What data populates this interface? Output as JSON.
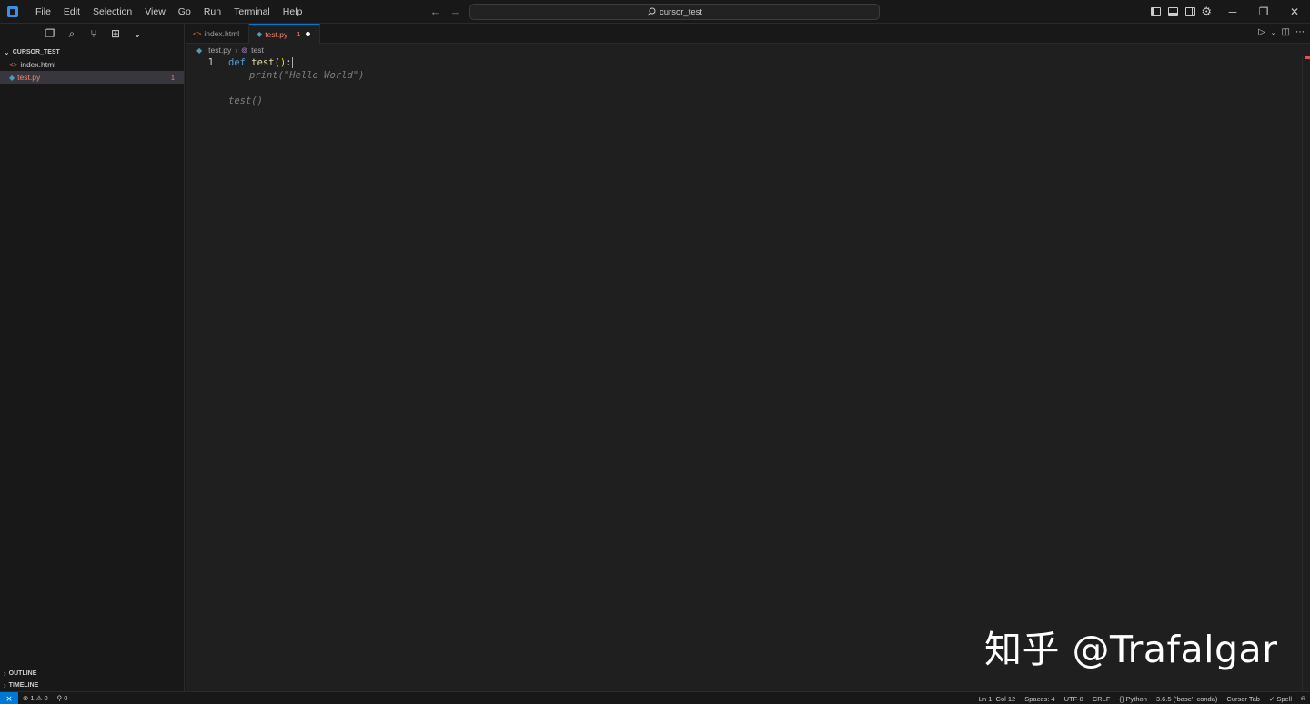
{
  "menu": [
    "File",
    "Edit",
    "Selection",
    "View",
    "Go",
    "Run",
    "Terminal",
    "Help"
  ],
  "command_center": {
    "label": "cursor_test",
    "icon": "search-icon"
  },
  "sidebar": {
    "folder": "CURSOR_TEST",
    "files": [
      {
        "name": "index.html",
        "icon": "html-file-icon",
        "badge": ""
      },
      {
        "name": "test.py",
        "icon": "python-file-icon",
        "badge": "1"
      }
    ],
    "sections": [
      "OUTLINE",
      "TIMELINE"
    ]
  },
  "tabs": [
    {
      "label": "index.html",
      "problems": ""
    },
    {
      "label": "test.py",
      "problems": "1"
    }
  ],
  "breadcrumb": {
    "file": "test.py",
    "symbol": "test"
  },
  "code": {
    "line1_no": "1",
    "line1_kw": "def",
    "line1_fn": "test",
    "line1_parens": "()",
    "line1_colon": ":",
    "ghost_line2": "print(\"Hello World\")",
    "ghost_line4": "test()"
  },
  "watermark": "知乎 @Trafalgar",
  "statusbar": {
    "errors": "1",
    "warnings": "0",
    "ports": "0",
    "position": "Ln 1, Col 12",
    "spaces": "Spaces: 4",
    "encoding": "UTF-8",
    "eol": "CRLF",
    "language": "Python",
    "interpreter": "3.6.5 ('base': conda)",
    "cursor_tab": "Cursor Tab",
    "spell": "Spell"
  },
  "colors": {
    "accent": "#0078d4",
    "error": "#f48771",
    "background": "#1f1f1f"
  }
}
